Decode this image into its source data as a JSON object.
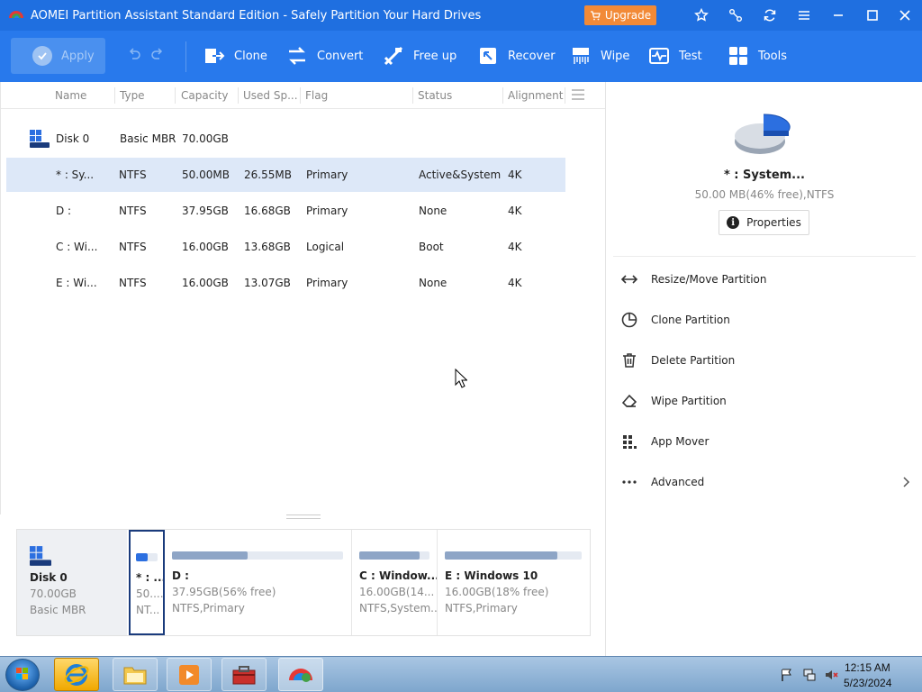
{
  "window": {
    "title": "AOMEI Partition Assistant Standard Edition - Safely Partition Your Hard Drives",
    "upgrade_label": "Upgrade"
  },
  "toolbar": {
    "apply_label": "Apply",
    "tools": [
      {
        "label": "Clone",
        "icon": "clone-icon"
      },
      {
        "label": "Convert",
        "icon": "convert-icon"
      },
      {
        "label": "Free up",
        "icon": "free-up-icon"
      },
      {
        "label": "Recover",
        "icon": "recover-icon"
      },
      {
        "label": "Wipe",
        "icon": "wipe-icon"
      },
      {
        "label": "Test",
        "icon": "test-icon"
      },
      {
        "label": "Tools",
        "icon": "tools-icon"
      }
    ]
  },
  "list": {
    "columns": [
      "Name",
      "Type",
      "Capacity",
      "Used Sp...",
      "Flag",
      "Status",
      "Alignment"
    ],
    "disk": {
      "name": "Disk 0",
      "type": "Basic MBR",
      "capacity": "70.00GB"
    },
    "rows": [
      {
        "name": "* : Sy...",
        "type": "NTFS",
        "capacity": "50.00MB",
        "used": "26.55MB",
        "flag": "Primary",
        "status": "Active&System",
        "alignment": "4K",
        "selected": true
      },
      {
        "name": "D :",
        "type": "NTFS",
        "capacity": "37.95GB",
        "used": "16.68GB",
        "flag": "Primary",
        "status": "None",
        "alignment": "4K"
      },
      {
        "name": "C : Wi...",
        "type": "NTFS",
        "capacity": "16.00GB",
        "used": "13.68GB",
        "flag": "Logical",
        "status": "Boot",
        "alignment": "4K"
      },
      {
        "name": "E : Wi...",
        "type": "NTFS",
        "capacity": "16.00GB",
        "used": "13.07GB",
        "flag": "Primary",
        "status": "None",
        "alignment": "4K"
      }
    ]
  },
  "diskmap": {
    "disk": {
      "name": "Disk 0",
      "size": "70.00GB",
      "type": "Basic MBR"
    },
    "partitions": [
      {
        "name": "* : ...",
        "size": "50....",
        "fs": "NT...",
        "used_fraction": 0.54,
        "selected": true
      },
      {
        "name": "D :",
        "size": "37.95GB(56% free)",
        "fs": "NTFS,Primary",
        "used_fraction": 0.44
      },
      {
        "name": "C : Window...",
        "size": "16.00GB(14...",
        "fs": "NTFS,System...",
        "used_fraction": 0.86
      },
      {
        "name": "E : Windows 10",
        "size": "16.00GB(18% free)",
        "fs": "NTFS,Primary",
        "used_fraction": 0.82
      }
    ]
  },
  "details": {
    "name": "* : System...",
    "detail": "50.00 MB(46% free),NTFS",
    "properties_label": "Properties",
    "operations": [
      {
        "label": "Resize/Move Partition",
        "icon": "resize-move-icon"
      },
      {
        "label": "Clone Partition",
        "icon": "clone-partition-icon"
      },
      {
        "label": "Delete Partition",
        "icon": "trash-icon"
      },
      {
        "label": "Wipe Partition",
        "icon": "eraser-icon"
      },
      {
        "label": "App Mover",
        "icon": "app-mover-icon"
      },
      {
        "label": "Advanced",
        "icon": "more-dots-icon"
      }
    ]
  },
  "taskbar": {
    "time": "12:15 AM",
    "date": "5/23/2024"
  },
  "colors": {
    "titlebar": "#1f6fe0",
    "toolbar": "#2879ec",
    "upgrade": "#f28a37",
    "selection": "#dde8f8",
    "accent": "#2c6fe0"
  }
}
